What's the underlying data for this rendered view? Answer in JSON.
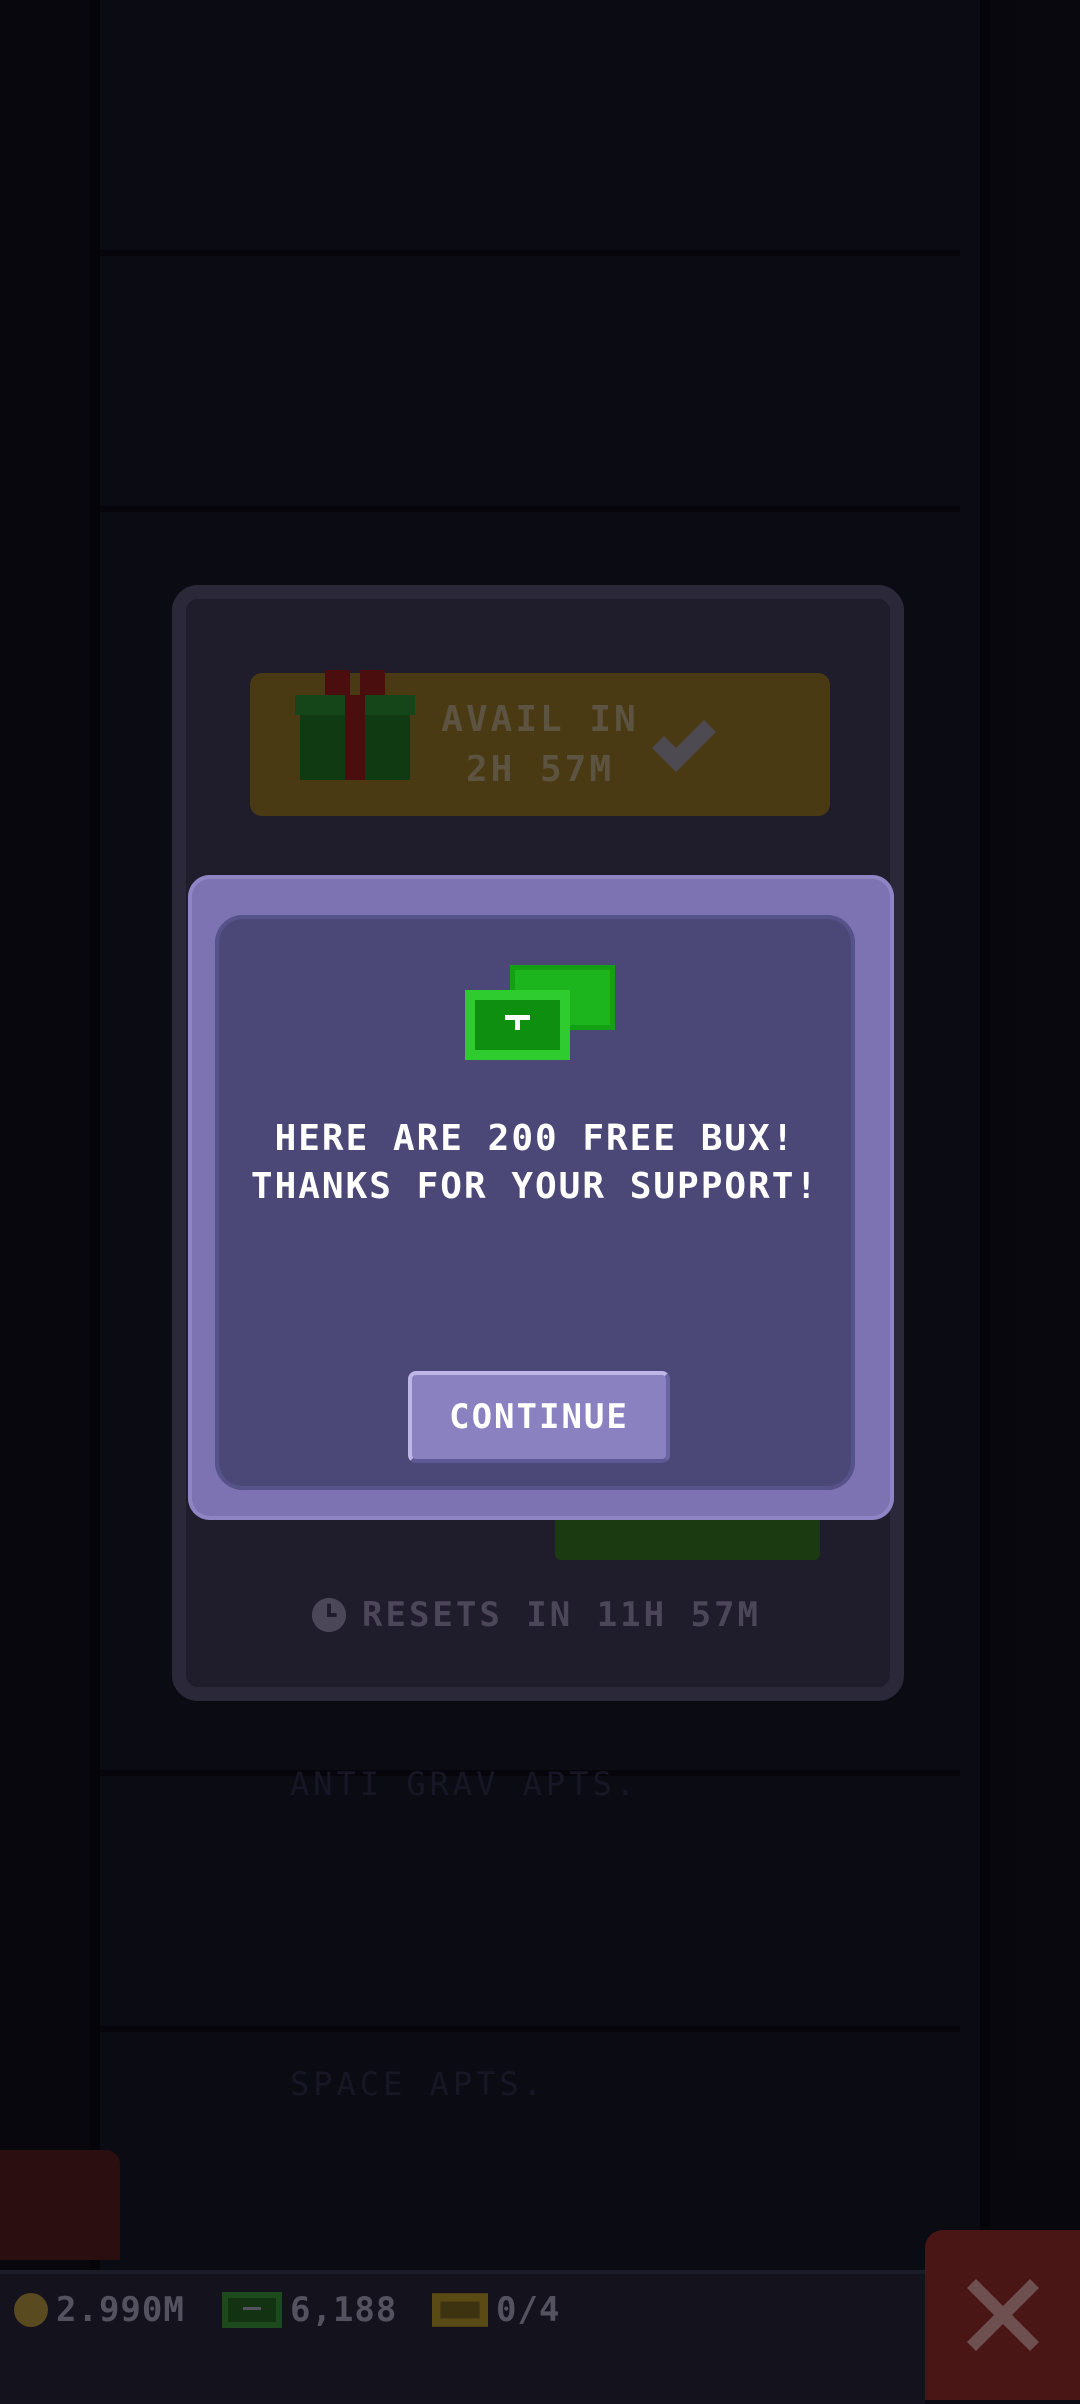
{
  "background": {
    "floors": [
      "ANTI GRAV APTS.",
      "SPACE APTS."
    ]
  },
  "gift_panel": {
    "avail_line1": "AVAIL IN",
    "avail_line2": "2H 57M"
  },
  "resets": {
    "text": "RESETS IN 11H 57M"
  },
  "dialog": {
    "line1": "HERE ARE 200 FREE BUX!",
    "line2": "THANKS FOR YOUR SUPPORT!",
    "continue_label": "CONTINUE"
  },
  "bottom_bar": {
    "coins": "2.990M",
    "bux": "6,188",
    "tickets": "0/4"
  },
  "colors": {
    "dialog_frame": "#7d72b2",
    "dialog_body": "#4b4777",
    "bux_green": "#2ecc2e",
    "close_red": "#4a1515"
  },
  "icons": [
    "gift-icon",
    "check-icon",
    "bux-icon",
    "clock-icon",
    "coin-icon",
    "ticket-icon",
    "close-icon"
  ]
}
